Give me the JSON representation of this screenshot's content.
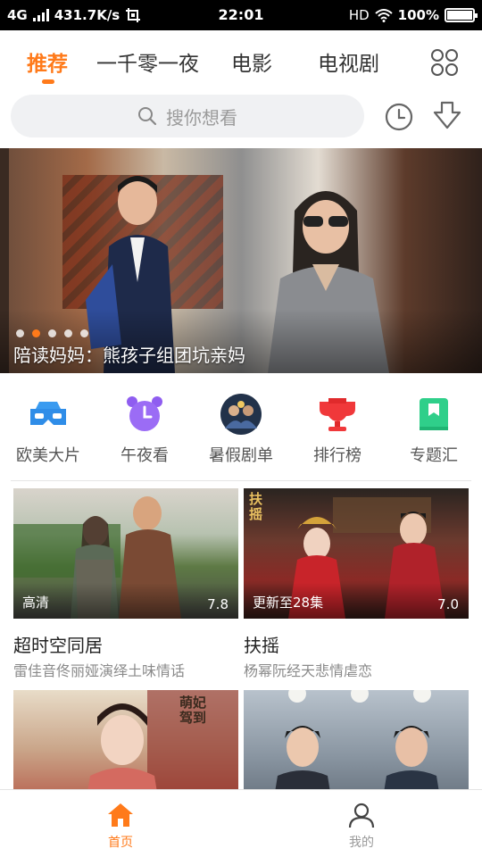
{
  "status_bar": {
    "network": "4G",
    "speed": "431.7K/s",
    "time": "22:01",
    "hd": "HD",
    "battery": "100%",
    "battery_level": 1.0
  },
  "tabs": [
    {
      "label": "推荐",
      "active": true
    },
    {
      "label": "一千零一夜",
      "active": false
    },
    {
      "label": "电影",
      "active": false
    },
    {
      "label": "电视剧",
      "active": false
    }
  ],
  "search": {
    "placeholder": "搜你想看"
  },
  "banner": {
    "caption": "陪读妈妈：熊孩子组团坑亲妈",
    "dot_count": 5,
    "active_dot": 1
  },
  "quick_entries": [
    {
      "label": "欧美大片",
      "icon": "vr-glasses-icon"
    },
    {
      "label": "午夜看",
      "icon": "alarm-clock-icon"
    },
    {
      "label": "暑假剧单",
      "icon": "poster-avatar-icon"
    },
    {
      "label": "排行榜",
      "icon": "trophy-icon"
    },
    {
      "label": "专题汇",
      "icon": "bookmark-book-icon"
    }
  ],
  "cards": [
    {
      "title": "超时空同居",
      "subtitle": "雷佳音佟丽娅演绎土味情话",
      "badge": "高清",
      "score": "7.8"
    },
    {
      "title": "扶摇",
      "subtitle": "杨幂阮经天悲情虐恋",
      "badge": "更新至28集",
      "score": "7.0",
      "poster_text": "扶摇"
    },
    {
      "title": "",
      "subtitle": "",
      "badge": "",
      "score": "",
      "poster_text": "萌妃驾到"
    },
    {
      "title": "",
      "subtitle": "",
      "badge": "",
      "score": ""
    }
  ],
  "bottom_nav": [
    {
      "label": "首页",
      "active": true
    },
    {
      "label": "我的",
      "active": false
    }
  ],
  "colors": {
    "accent": "#ff7a1a",
    "text": "#333333",
    "muted": "#8a8a8a",
    "search_bg": "#f0f1f3"
  }
}
